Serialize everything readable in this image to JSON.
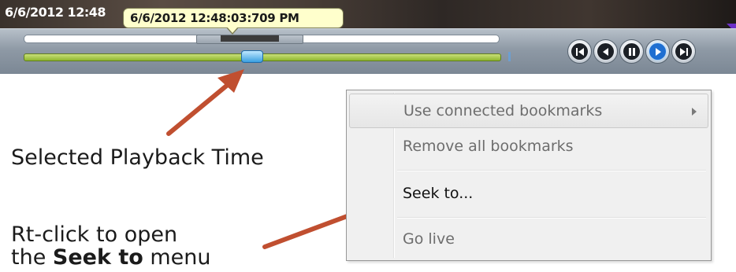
{
  "player": {
    "top_time": "6/6/2012 12:48",
    "tooltip_time": "6/6/2012 12:48:03:709 PM",
    "playback_position": 0.48,
    "controls": [
      {
        "name": "skip-to-start-icon",
        "active": false
      },
      {
        "name": "step-back-icon",
        "active": false
      },
      {
        "name": "pause-icon",
        "active": false
      },
      {
        "name": "play-icon",
        "active": true
      },
      {
        "name": "skip-to-end-icon",
        "active": false
      }
    ]
  },
  "annotations": {
    "selected_caption": "Selected Playback Time",
    "rtclick_line1": "Rt-click to open",
    "rtclick_line2_prefix": "the ",
    "rtclick_line2_bold": "Seek to",
    "rtclick_line2_suffix": " menu",
    "arrow_color": "#c04f30"
  },
  "context_menu": {
    "items": [
      {
        "label": "Use connected bookmarks",
        "enabled": false,
        "has_submenu": true,
        "highlighted": true
      },
      {
        "label": "Remove all bookmarks",
        "enabled": false,
        "has_submenu": false,
        "highlighted": false
      },
      {
        "label": "Seek to...",
        "enabled": true,
        "has_submenu": false,
        "highlighted": false
      },
      {
        "label": "Go live",
        "enabled": false,
        "has_submenu": false,
        "highlighted": false
      }
    ]
  },
  "colors": {
    "timeline_green": "#8fb82e",
    "playhead_blue": "#3a9fe0",
    "tooltip_bg": "#ffffcc",
    "active_control": "#1f6fd1"
  }
}
